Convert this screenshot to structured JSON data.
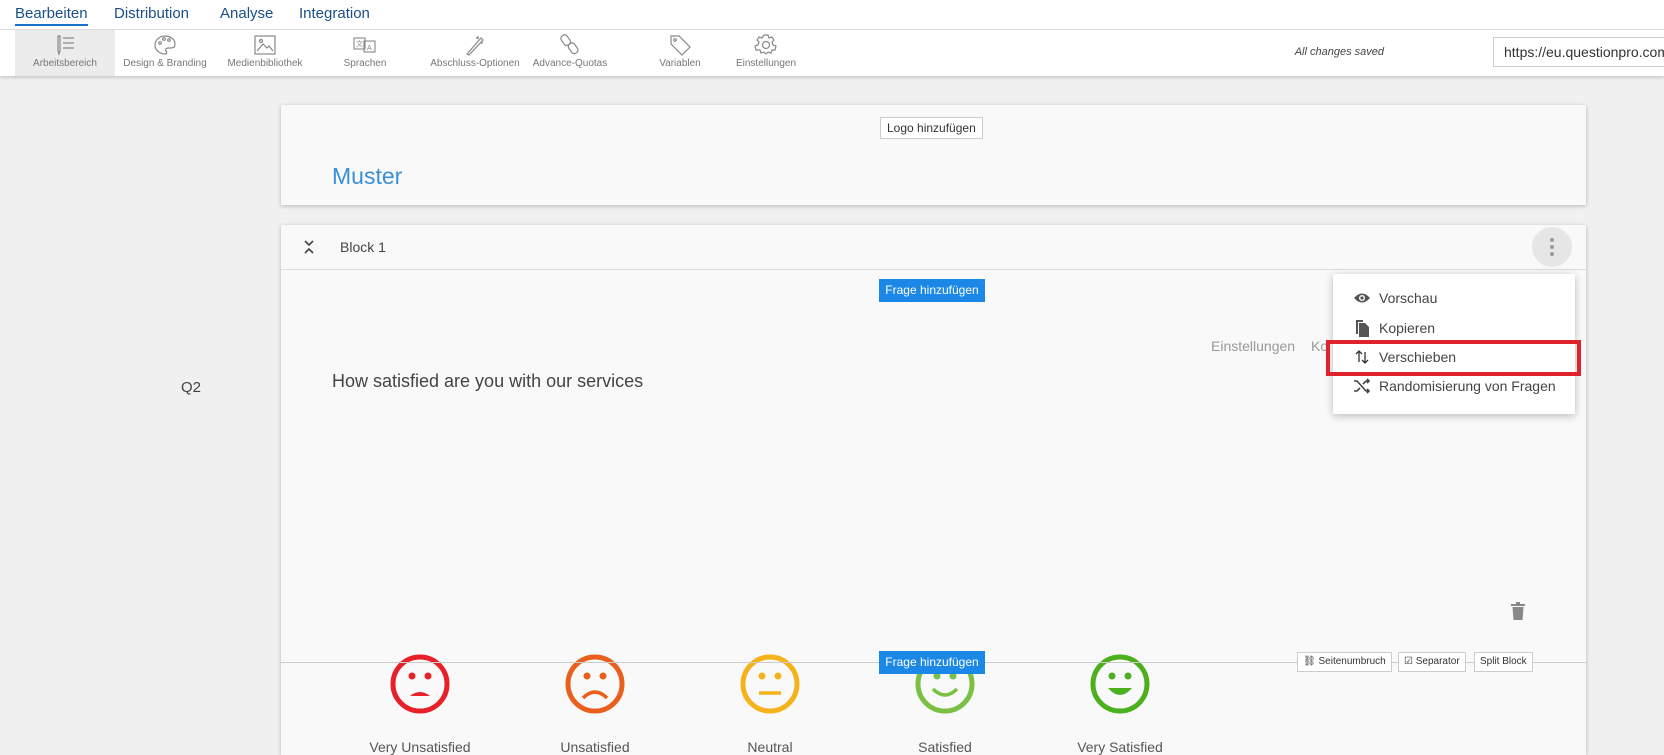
{
  "topnav": {
    "tabs": [
      {
        "label": "Bearbeiten",
        "active": true
      },
      {
        "label": "Distribution"
      },
      {
        "label": "Analyse"
      },
      {
        "label": "Integration"
      }
    ]
  },
  "toolbar": {
    "items": [
      {
        "label": "Arbeitsbereich",
        "icon": "workspace-icon",
        "active": true
      },
      {
        "label": "Design & Branding",
        "icon": "palette-icon"
      },
      {
        "label": "Medienbibliothek",
        "icon": "image-icon"
      },
      {
        "label": "Sprachen",
        "icon": "translate-icon"
      },
      {
        "label": "Abschluss-Optionen",
        "icon": "magic-wand-icon"
      },
      {
        "label": "Advance-Quotas",
        "icon": "link-icon"
      },
      {
        "label": "Variablen",
        "icon": "tag-icon"
      },
      {
        "label": "Einstellungen",
        "icon": "gear-icon"
      }
    ],
    "status": "All changes saved",
    "url": "https://eu.questionpro.com/t"
  },
  "header_card": {
    "logo_button": "Logo hinzufügen",
    "title": "Muster"
  },
  "block": {
    "title": "Block 1",
    "add_question": "Frage hinzufügen",
    "settings_link": "Einstellungen",
    "copy_link_partial": "Ko",
    "question_number": "Q2",
    "question": "How satisfied are you with our services",
    "options": [
      {
        "label": "Very Unsatisfied",
        "color": "#e8202a"
      },
      {
        "label": "Unsatisfied",
        "color": "#e8601c"
      },
      {
        "label": "Neutral",
        "color": "#f5b31b"
      },
      {
        "label": "Satisfied",
        "color": "#7ac143"
      },
      {
        "label": "Very Satisfied",
        "color": "#4caf1e"
      }
    ],
    "footer": {
      "add_question": "Frage hinzufügen",
      "page_break": "Seitenumbruch",
      "separator": "Separator",
      "split_block": "Split Block"
    }
  },
  "menu": {
    "items": [
      {
        "label": "Vorschau",
        "icon": "eye-icon"
      },
      {
        "label": "Kopieren",
        "icon": "copy-icon"
      },
      {
        "label": "Verschieben",
        "icon": "move-icon",
        "highlighted": true
      },
      {
        "label": "Randomisierung von Fragen",
        "icon": "shuffle-icon"
      }
    ]
  },
  "colors": {
    "accent": "#1b87e6",
    "highlight": "#e0222b",
    "title": "#3a8fd8"
  }
}
